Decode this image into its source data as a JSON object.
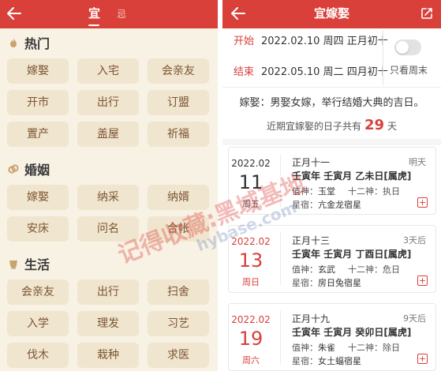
{
  "left": {
    "tabs": [
      {
        "label": "宜"
      },
      {
        "label": "忌"
      }
    ],
    "sections": [
      {
        "title": "热门",
        "icon": "flame-icon",
        "items": [
          "嫁娶",
          "入宅",
          "会亲友",
          "开市",
          "出行",
          "订盟",
          "置产",
          "盖屋",
          "祈福"
        ]
      },
      {
        "title": "婚姻",
        "icon": "rings-icon",
        "items": [
          "嫁娶",
          "纳采",
          "纳婿",
          "安床",
          "问名",
          "合帐"
        ]
      },
      {
        "title": "生活",
        "icon": "cup-icon",
        "items": [
          "会亲友",
          "出行",
          "扫舍",
          "入学",
          "理发",
          "习艺",
          "伐木",
          "栽种",
          "求医"
        ]
      }
    ]
  },
  "right": {
    "title": "宜嫁娶",
    "start": {
      "label": "开始",
      "date": "2022.02.10",
      "weekday": "周四",
      "lunar": "正月初十"
    },
    "end": {
      "label": "结束",
      "date": "2022.05.10",
      "weekday": "周二",
      "lunar": "四月初十"
    },
    "toggle_label": "只看周末",
    "description": "嫁娶：男娶女嫁，举行结婚大典的吉日。",
    "summary_prefix": "近期宜嫁娶的日子共有",
    "summary_count": "29",
    "summary_suffix": "天",
    "labels": {
      "zhishen": "值神：",
      "shier": "十二神：",
      "xingxiu": "星宿："
    },
    "days": [
      {
        "ym": "2022.02",
        "day": "11",
        "weekday": "周五",
        "lunar": "正月十一",
        "relative": "明天",
        "ganzhi": "壬寅年 壬寅月 乙未日[属虎]",
        "zhishen": "玉堂",
        "shier": "执日",
        "xingxiu": "亢金龙宿星",
        "weekend": false
      },
      {
        "ym": "2022.02",
        "day": "13",
        "weekday": "周日",
        "lunar": "正月十三",
        "relative": "3天后",
        "ganzhi": "壬寅年 壬寅月 丁酉日[属虎]",
        "zhishen": "玄武",
        "shier": "危日",
        "xingxiu": "房日兔宿星",
        "weekend": true
      },
      {
        "ym": "2022.02",
        "day": "19",
        "weekday": "周六",
        "lunar": "正月十九",
        "relative": "9天后",
        "ganzhi": "壬寅年 壬寅月 癸卯日[属虎]",
        "zhishen": "朱雀",
        "shier": "除日",
        "xingxiu": "女土蝠宿星",
        "weekend": true
      }
    ]
  },
  "watermark": {
    "text1": "记得收藏:黑域基地",
    "text2": "hybase.com"
  },
  "colors": {
    "accent": "#d9403a",
    "chip_bg": "#f0e5ce",
    "chip_text": "#7b5433",
    "panel_bg": "#f8f2e4"
  }
}
